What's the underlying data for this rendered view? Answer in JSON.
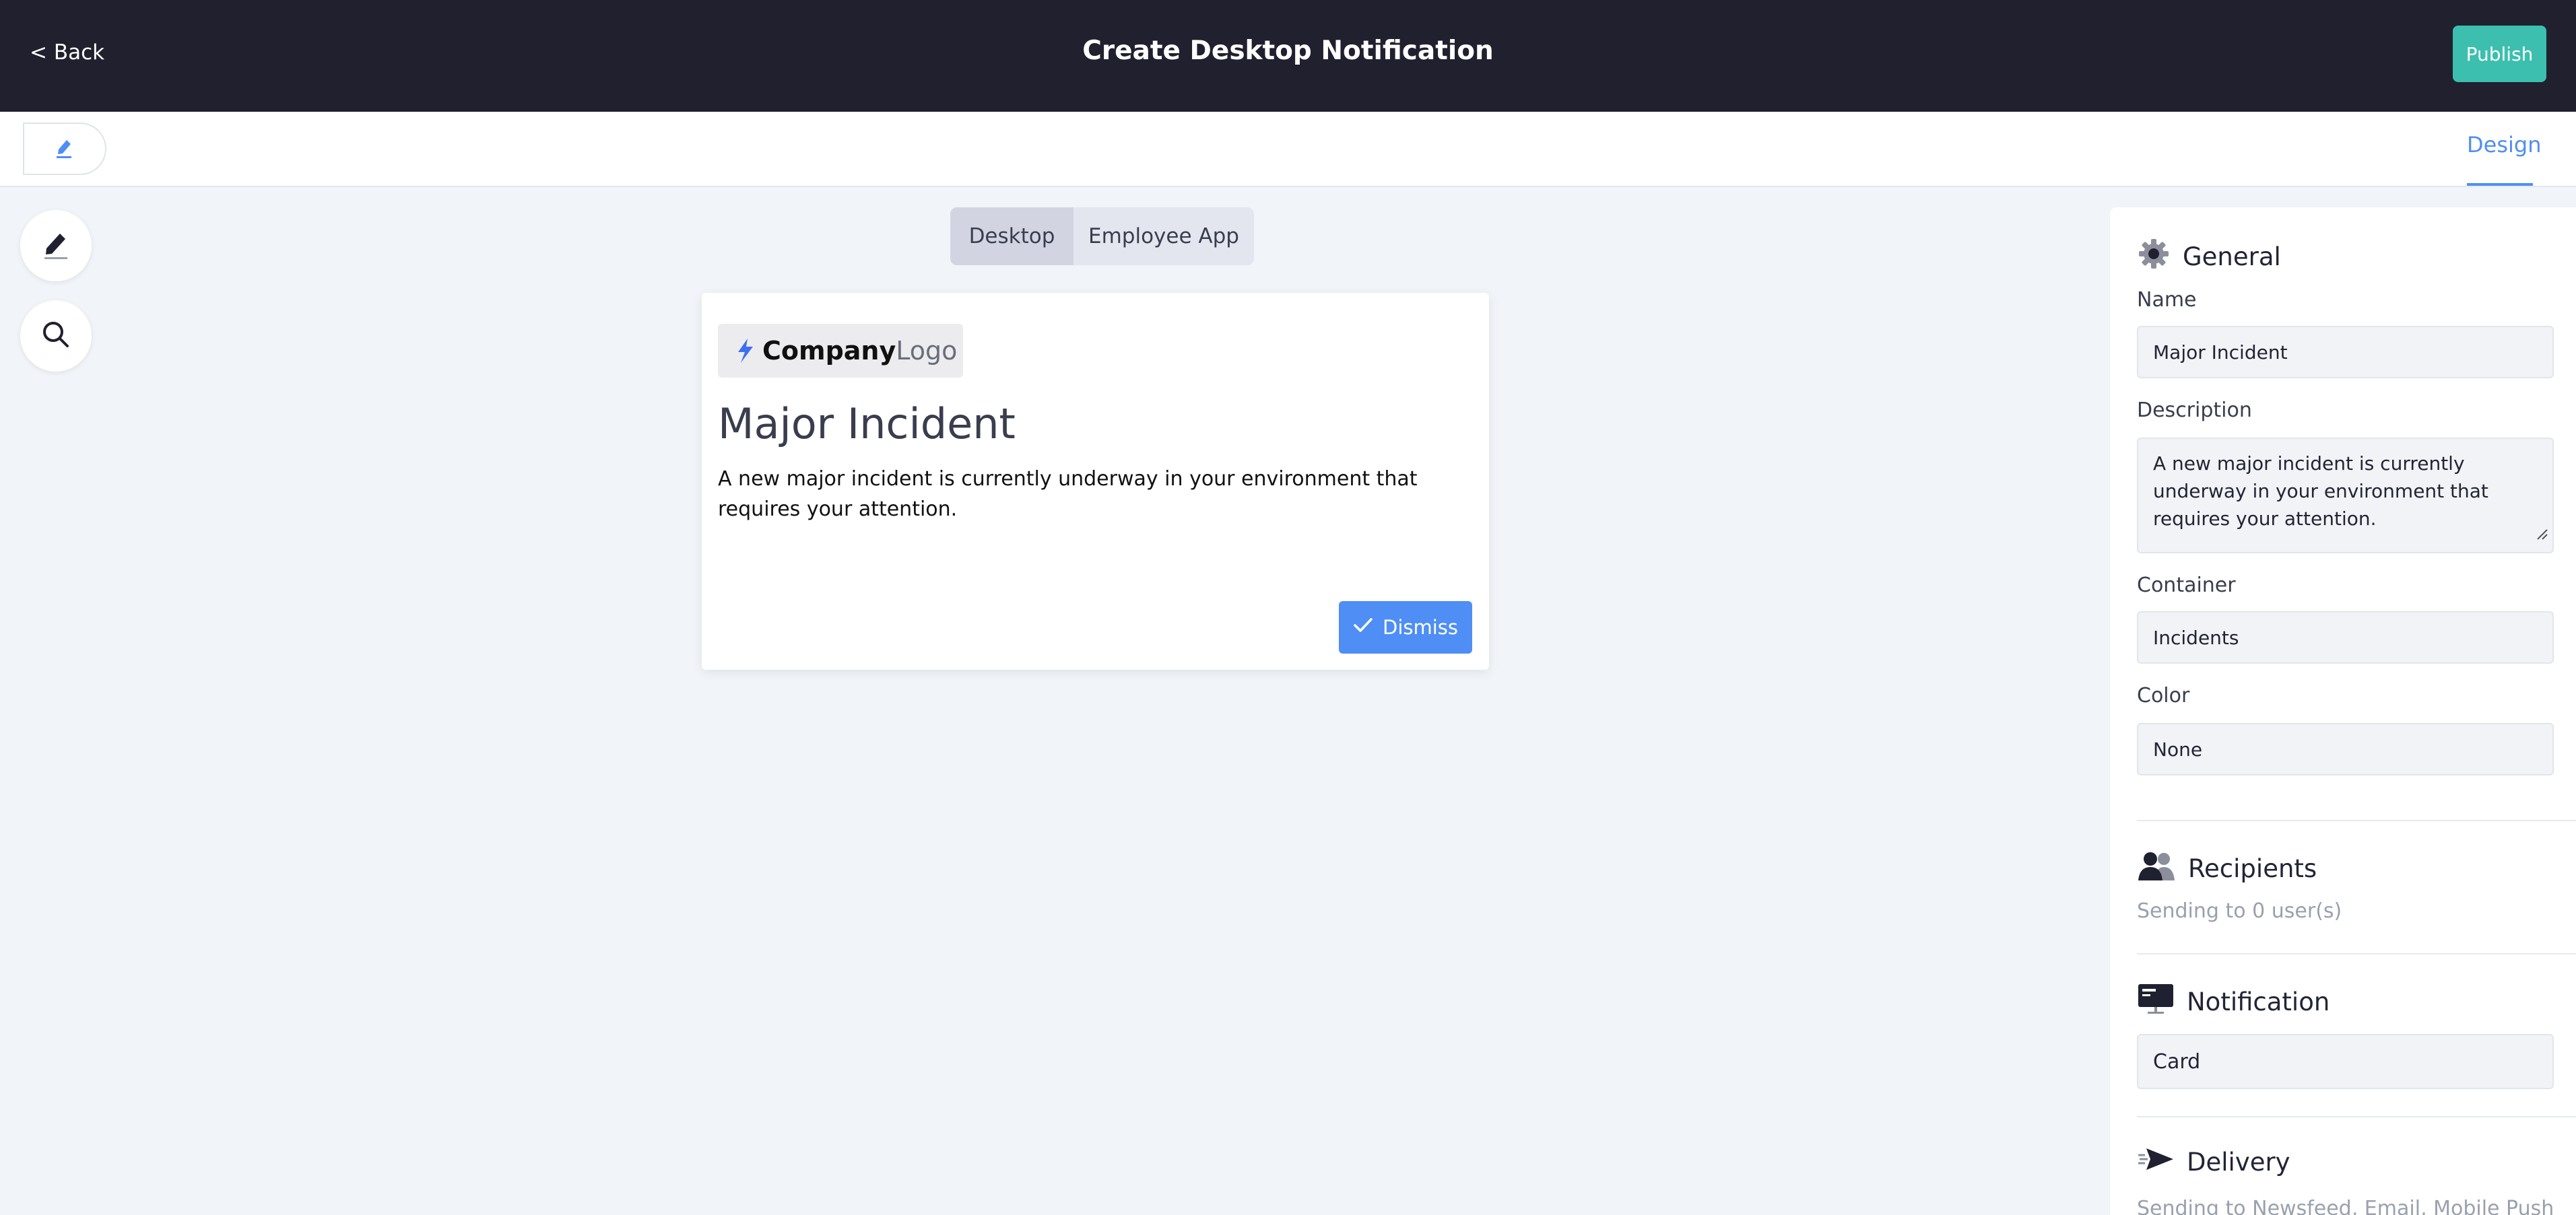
{
  "header": {
    "back_label": "< Back",
    "title": "Create Desktop Notification",
    "publish_label": "Publish"
  },
  "subbar": {
    "design_tab": "Design"
  },
  "left_rail": {
    "items": [
      "edit-icon",
      "search-icon"
    ]
  },
  "view_toggle": {
    "options": [
      "Desktop",
      "Employee App"
    ],
    "selected": "Desktop"
  },
  "preview": {
    "logo_company": "Company",
    "logo_suffix": "Logo",
    "title": "Major Incident",
    "body": "A new major incident is currently underway in your environment that requires your attention.",
    "dismiss_label": "Dismiss"
  },
  "panel": {
    "general": {
      "heading": "General",
      "name_label": "Name",
      "name_value": "Major Incident",
      "description_label": "Description",
      "description_value": "A new major incident is currently underway in your environment that requires your attention.",
      "container_label": "Container",
      "container_value": "Incidents",
      "color_label": "Color",
      "color_value": "None"
    },
    "recipients": {
      "heading": "Recipients",
      "summary": "Sending to 0 user(s)"
    },
    "notification": {
      "heading": "Notification",
      "value": "Card"
    },
    "delivery": {
      "heading": "Delivery",
      "summary": "Sending to Newsfeed, Email, Mobile Push"
    }
  },
  "colors": {
    "topbar": "#20202f",
    "publish": "#3cbfae",
    "accent": "#4f8ef4",
    "canvas": "#f1f4f8"
  }
}
